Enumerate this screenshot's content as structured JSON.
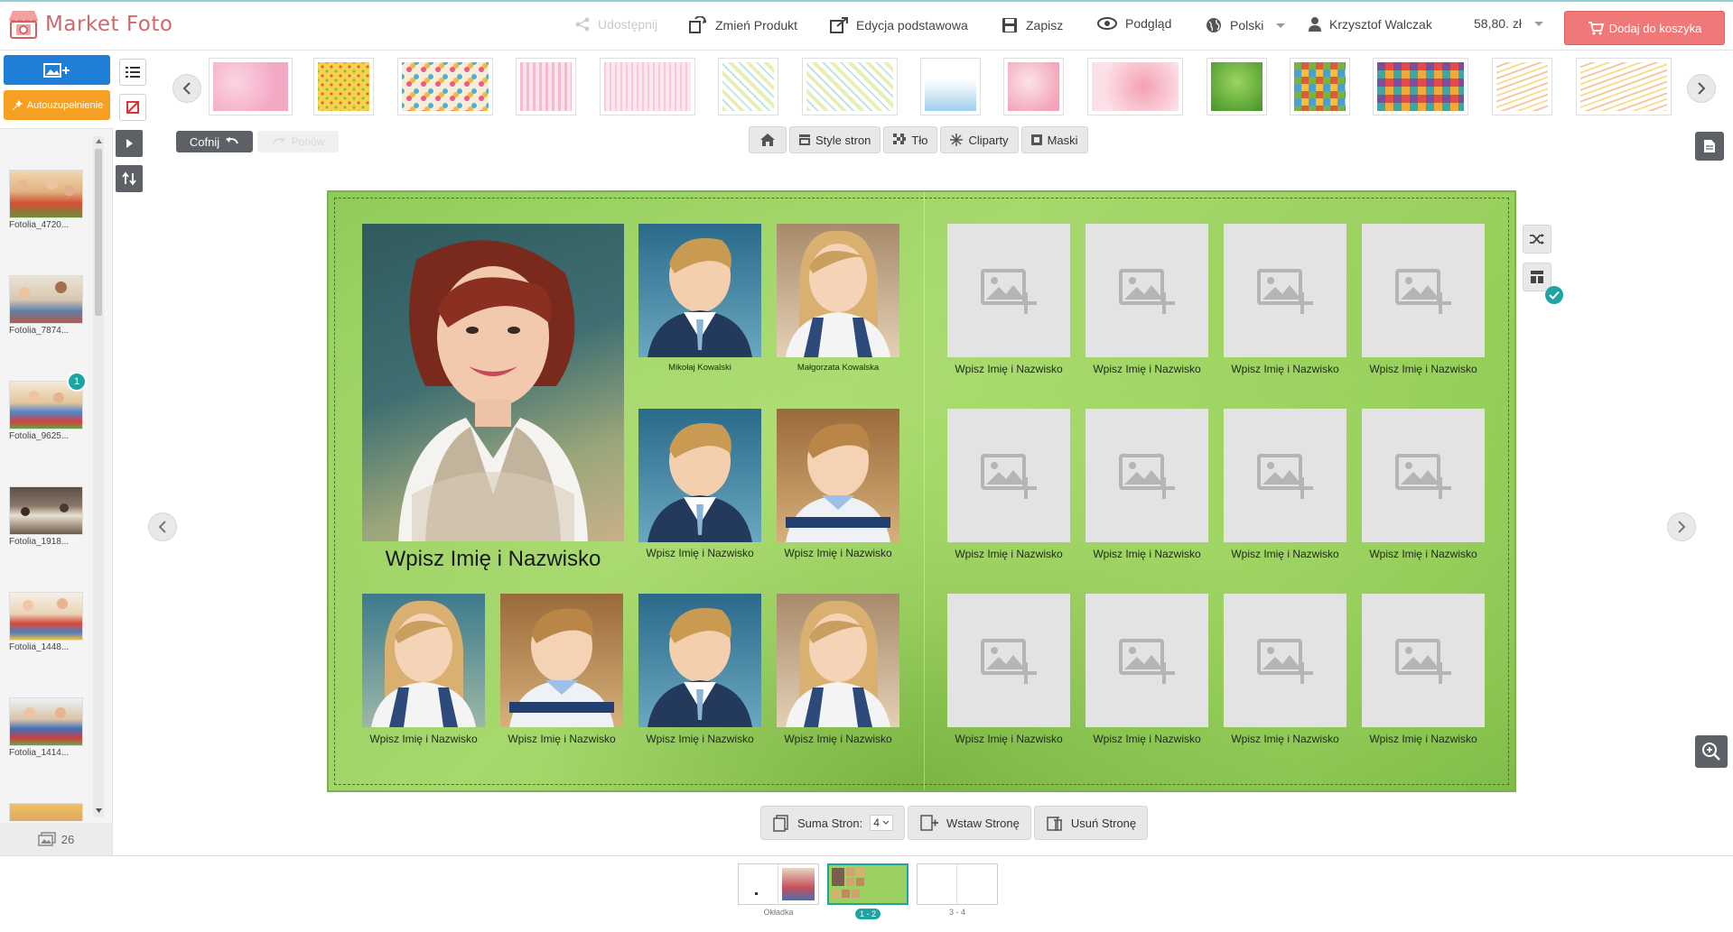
{
  "header": {
    "brand": "Market Foto",
    "share_label": "Udostępnij",
    "change_product_label": "Zmień Produkt",
    "edition_label": "Edycja podstawowa",
    "save_label": "Zapisz",
    "preview_label": "Podgląd",
    "language_label": "Polski",
    "user_name": "Krzysztof Walczak",
    "price": "58,80. zł",
    "cart_label": "Dodaj do koszyka"
  },
  "left_panel": {
    "autofill_label": "Autouzupełnienie",
    "photos": [
      {
        "name": "Fotolia_4720...",
        "badge": ""
      },
      {
        "name": "Fotolia_7874...",
        "badge": ""
      },
      {
        "name": "Fotolia_9625...",
        "badge": "1"
      },
      {
        "name": "Fotolia_1918...",
        "badge": ""
      },
      {
        "name": "Fotolia_1448...",
        "badge": ""
      },
      {
        "name": "Fotolia_1414...",
        "badge": ""
      }
    ],
    "photo_count": "26"
  },
  "toolbar": {
    "undo_label": "Cofnij",
    "redo_label": "Ponów",
    "tabs": [
      "Style stron",
      "Tło",
      "Cliparty",
      "Maski"
    ]
  },
  "canvas": {
    "teacher_label": "Wpisz Imię i Nazwisko",
    "kid_labels": [
      "Mikołaj Kowalski",
      "Małgorzata Kowalska",
      "Wpisz Imię i Nazwisko",
      "Wpisz Imię i Nazwisko",
      "Wpisz Imię i Nazwisko",
      "Wpisz Imię i Nazwisko",
      "Wpisz Imię i Nazwisko",
      "Wpisz Imię i Nazwisko"
    ],
    "empty_label": "Wpisz Imię i Nazwisko"
  },
  "pagebar": {
    "total_pages_label": "Suma Stron:",
    "total_pages_value": "4",
    "insert_label": "Wstaw Stronę",
    "delete_label": "Usuń Stronę"
  },
  "footer": {
    "spreads": [
      {
        "label": "Okładka",
        "active": false
      },
      {
        "label": "1 - 2",
        "active": true
      },
      {
        "label": "3 - 4",
        "active": false
      }
    ]
  },
  "colors": {
    "brand": "#cc6b6b",
    "cart": "#f07878",
    "upload": "#1f7fd6",
    "autofill": "#f5a022",
    "accent": "#20a3a3",
    "page_background": "#97cf5c"
  }
}
